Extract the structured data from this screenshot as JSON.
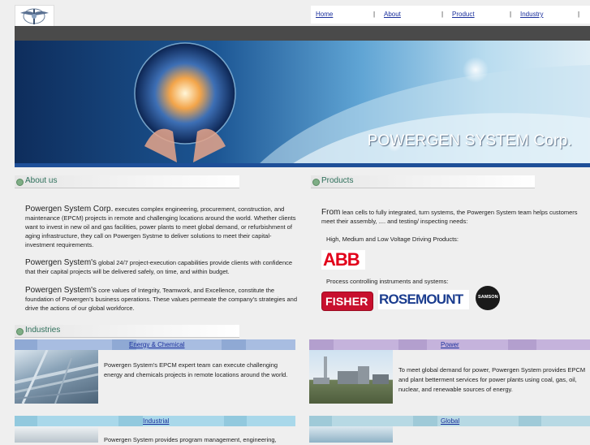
{
  "nav": {
    "items": [
      "Home",
      "About",
      "Product",
      "Industry"
    ],
    "separator": "|"
  },
  "banner": {
    "title": "POWERGEN SYSTEM Corp."
  },
  "about": {
    "heading": "About us",
    "p1_lead": "Powergen System Corp.",
    "p1_body": " executes complex engineering, procurement, construction, and maintenance (EPCM) projects in remote and challenging locations around the world. Whether clients want to invest in new oil and gas facilities, power plants to meet global demand, or refurbishment of aging infrastructure, they call on Powergen Systme to deliver solutions to meet their capital-investment requirements.",
    "p2_lead": "Powergen System's",
    "p2_body": " global 24/7 project-execution capabilities provide clients with confidence that their capital projects will be delivered safely, on time, and within budget.",
    "p3_lead": "Powergen System's",
    "p3_body": " core values of Integrity, Teamwork, and Excellence, constitute the foundation of Powergen's business operations. These values permeate the company's strategies and drive the actions of our global workforce."
  },
  "products": {
    "heading": "Products",
    "intro_lead": "From",
    "intro_body": " lean cells to fully integrated, turn systems, the Powergen System team helps customers meet their assembly, .... and testing/ inspecting needs:",
    "line1": "High, Medium and Low Voltage Driving Products:",
    "line2": "Process controlling instruments and systems:",
    "brands": [
      "ABB",
      "FISHER",
      "ROSEMOUNT",
      "SAMSON"
    ]
  },
  "industries": {
    "heading": "Industries",
    "energy": {
      "title": "Energy & Chemical",
      "text": "Powergen System's EPCM expert team can execute challenging energy and chemicals projects in remote locations around the world."
    },
    "power": {
      "title": "Power",
      "text": "To meet global demand for power, Powergen System provides EPCM and plant betterment services for power plants using coal, gas, oil, nuclear, and renewable sources of energy."
    },
    "industrial": {
      "title": "Industrial",
      "text": "Powergen System provides program management, engineering,"
    },
    "global": {
      "title": "Global"
    }
  },
  "colors": {
    "link": "#1a2f9c",
    "section_heading": "#2d6f5a",
    "dark_bar": "#4a4a4a",
    "banner_bottom": "#1e4f98"
  },
  "icons": [
    "logo-emblem-icon",
    "section-bullet-icon"
  ]
}
